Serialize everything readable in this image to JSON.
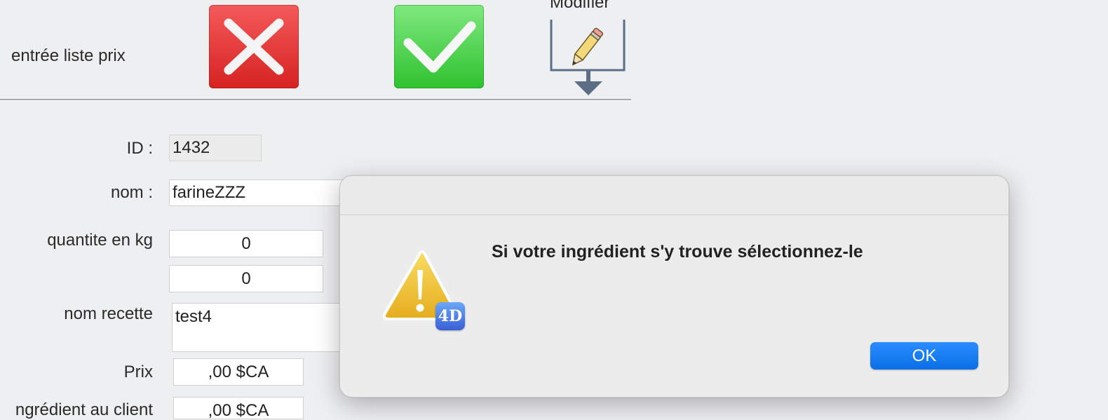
{
  "toolbar": {
    "title": "entrée liste prix",
    "cancel_icon": "x-mark-icon",
    "validate_icon": "check-mark-icon",
    "modify_label": "Modifier",
    "modify_icon": "pencil-icon"
  },
  "form": {
    "id_label": "ID :",
    "id_value": "1432",
    "nom_label": "nom :",
    "nom_value": "farineZZZ",
    "quantite_label": "quantite en kg",
    "quantite_value": "0",
    "quantite_value_2": "0",
    "nom_recette_label": "nom recette",
    "nom_recette_value": "test4",
    "prix_label": "Prix",
    "prix_value": ",00 $CA",
    "prix_client_label": "ngrédient au client",
    "prix_client_value": ",00 $CA"
  },
  "dialog": {
    "message": "Si votre ingrédient s'y trouve sélectionnez-le",
    "ok_label": "OK",
    "icon": "warning-icon",
    "badge_text": "4D"
  },
  "colors": {
    "cancel_red": "#e03434",
    "validate_green": "#44cc44",
    "ok_blue": "#147ef5",
    "warning_yellow": "#f2c230"
  }
}
